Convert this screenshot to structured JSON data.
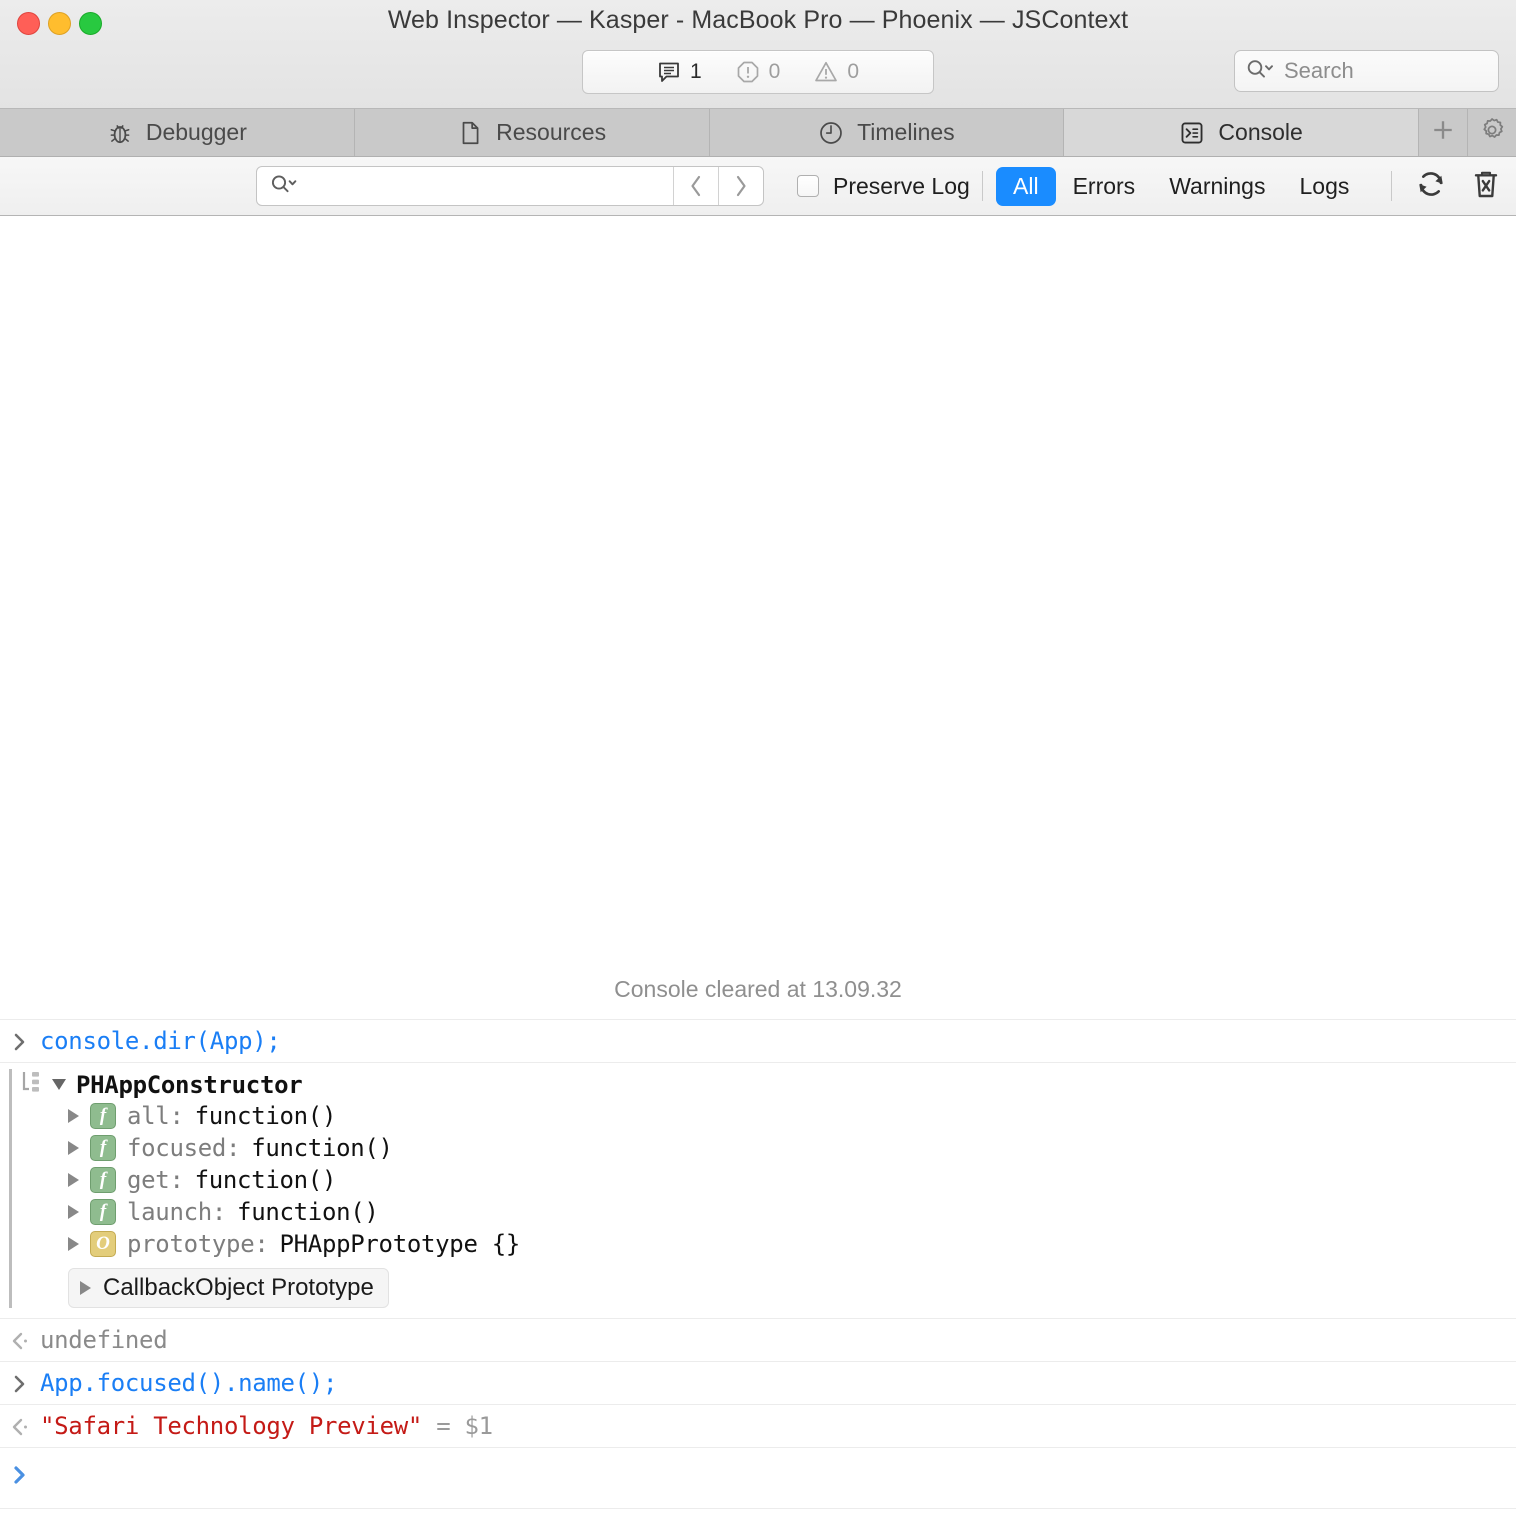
{
  "window": {
    "title": "Web Inspector — Kasper - MacBook Pro — Phoenix — JSContext",
    "traffic_lights": [
      "close",
      "minimize",
      "maximize"
    ]
  },
  "counters": {
    "logs": {
      "icon": "speech-bubble-icon",
      "value": "1"
    },
    "errors": {
      "icon": "error-octagon-icon",
      "value": "0"
    },
    "warnings": {
      "icon": "warning-triangle-icon",
      "value": "0"
    }
  },
  "search": {
    "icon": "search-magnifier-icon",
    "placeholder": "Search",
    "value": ""
  },
  "tabs": [
    {
      "label": "Debugger",
      "icon": "bug-icon",
      "active": false
    },
    {
      "label": "Resources",
      "icon": "document-icon",
      "active": false
    },
    {
      "label": "Timelines",
      "icon": "clock-icon",
      "active": false
    },
    {
      "label": "Console",
      "icon": "terminal-prompt-icon",
      "active": true
    }
  ],
  "tab_actions": [
    {
      "name": "add-tab-button",
      "icon": "plus-icon"
    },
    {
      "name": "settings-button",
      "icon": "gear-icon"
    }
  ],
  "toolbar": {
    "filter_search": {
      "icon": "search-magnifier-icon",
      "value": "",
      "placeholder": ""
    },
    "prev_label": "‹",
    "next_label": "›",
    "preserve_log": {
      "label": "Preserve Log",
      "checked": false
    },
    "filters": [
      {
        "label": "All",
        "active": true
      },
      {
        "label": "Errors",
        "active": false
      },
      {
        "label": "Warnings",
        "active": false
      },
      {
        "label": "Logs",
        "active": false
      }
    ],
    "actions": [
      {
        "name": "refresh-button",
        "icon": "refresh-cycle-icon"
      },
      {
        "name": "clear-console-button",
        "icon": "trash-x-icon"
      }
    ],
    "accent_color": "#1a8cff"
  },
  "console": {
    "cleared_notice": "Console cleared at 13.09.32",
    "entries": [
      {
        "kind": "input",
        "prompt": "›",
        "text": "console.dir(App);"
      },
      {
        "kind": "object",
        "gutter_icon": "console-dir-tree-icon",
        "title": "PHAppConstructor",
        "expanded": true,
        "properties": [
          {
            "badge": "f",
            "badge_type": "function",
            "name": "all:",
            "value": "function()"
          },
          {
            "badge": "f",
            "badge_type": "function",
            "name": "focused:",
            "value": "function()"
          },
          {
            "badge": "f",
            "badge_type": "function",
            "name": "get:",
            "value": "function()"
          },
          {
            "badge": "f",
            "badge_type": "function",
            "name": "launch:",
            "value": "function()"
          },
          {
            "badge": "O",
            "badge_type": "object",
            "name": "prototype:",
            "value": "PHAppPrototype {}"
          }
        ],
        "prototype_box": "CallbackObject Prototype"
      },
      {
        "kind": "output",
        "prompt": "‹",
        "text": "undefined",
        "style": "undefined"
      },
      {
        "kind": "input",
        "prompt": "›",
        "text": "App.focused().name();"
      },
      {
        "kind": "output",
        "prompt": "‹",
        "string_value": "\"Safari Technology Preview\"",
        "saved_ref": "= $1",
        "style": "string"
      }
    ],
    "prompt": {
      "caret": "›",
      "value": ""
    },
    "colors": {
      "input": "#1a7ef5",
      "string": "#c41a16",
      "muted": "#8a8a8a"
    }
  }
}
